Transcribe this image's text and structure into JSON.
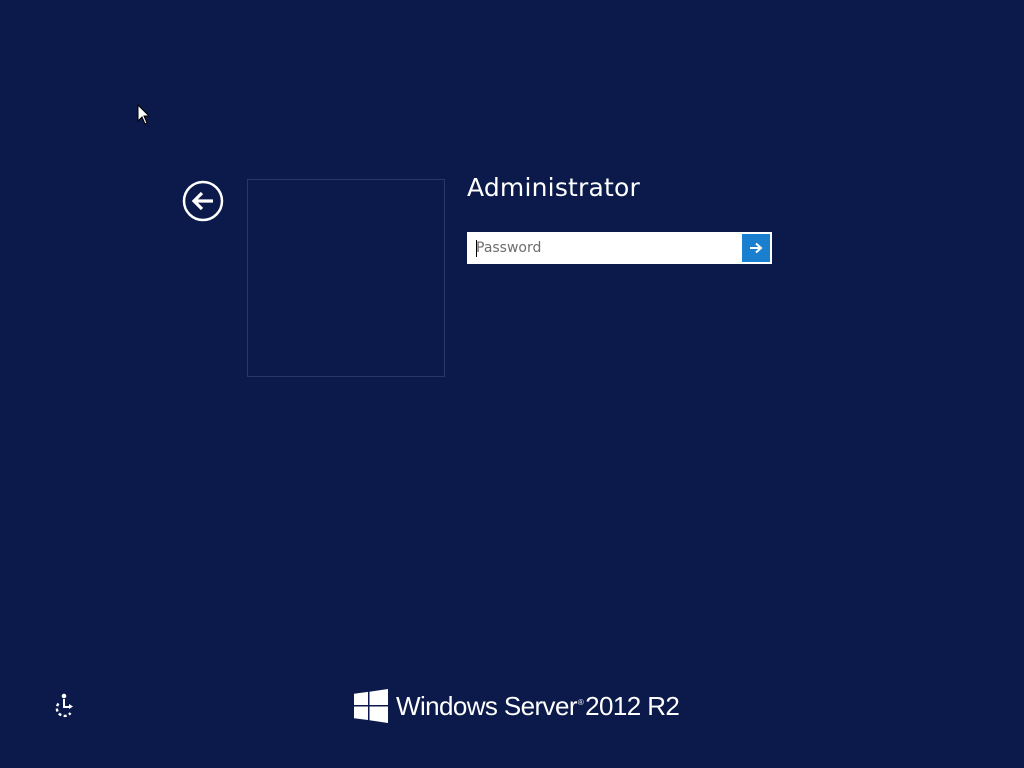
{
  "login": {
    "username": "Administrator",
    "password_placeholder": "Password",
    "password_value": ""
  },
  "brand": {
    "product_name": "Windows Server",
    "trademark": "®",
    "version": "2012 R2"
  },
  "icons": {
    "back": "back-arrow-icon",
    "submit": "arrow-right-icon",
    "ease_of_access": "ease-of-access-icon",
    "logo": "windows-logo-icon",
    "cursor": "mouse-pointer-icon"
  },
  "colors": {
    "background": "#0b1a4a",
    "submit_accent": "#1b7fd0",
    "text": "#ffffff"
  }
}
